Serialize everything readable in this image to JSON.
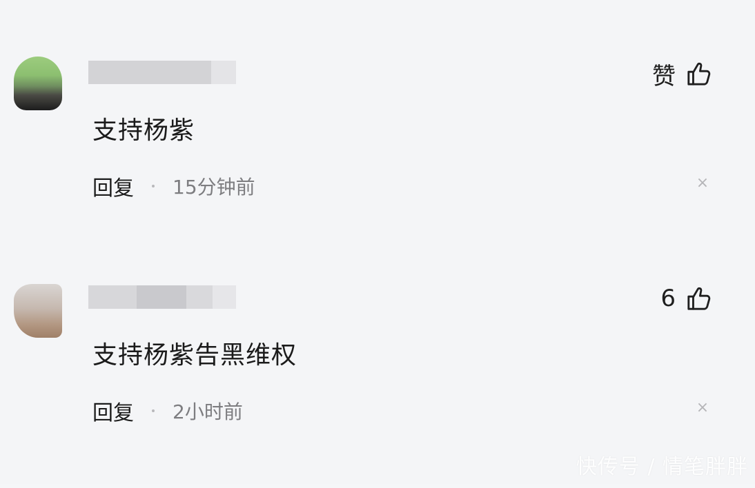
{
  "comments": [
    {
      "text": "支持杨紫",
      "like_label": "赞",
      "reply_label": "回复",
      "time": "15分钟前",
      "close_glyph": "×"
    },
    {
      "text": "支持杨紫告黑维权",
      "like_label": "6",
      "reply_label": "回复",
      "time": "2小时前",
      "close_glyph": "×"
    }
  ],
  "watermark": "快传号 / 情笔胖胖",
  "icons": {
    "like": "thumbs-up-icon",
    "close": "close-icon"
  }
}
